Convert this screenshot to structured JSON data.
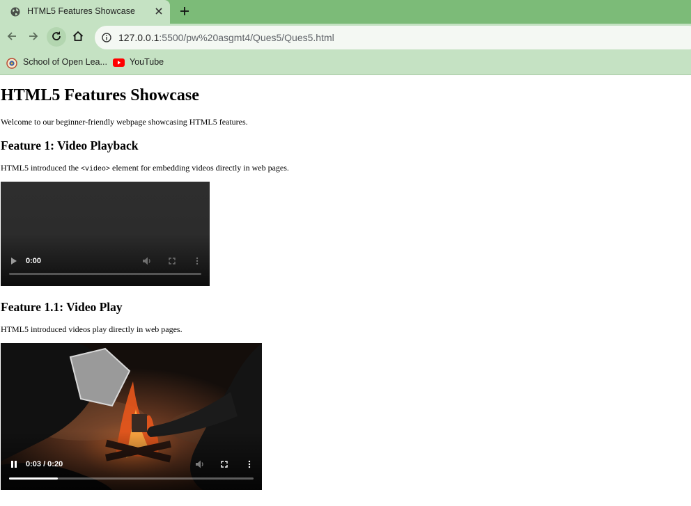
{
  "browser": {
    "tab": {
      "title": "HTML5 Features Showcase"
    },
    "url": {
      "host": "127.0.0.1",
      "rest": ":5500/pw%20asgmt4/Ques5/Ques5.html"
    },
    "bookmarks": [
      {
        "label": "School of Open Lea..."
      },
      {
        "label": "YouTube"
      }
    ]
  },
  "page": {
    "title": "HTML5 Features Showcase",
    "intro": "Welcome to our beginner-friendly webpage showcasing HTML5 features.",
    "feature1": {
      "heading": "Feature 1: Video Playback",
      "text_before": "HTML5 introduced the ",
      "code": "<video>",
      "text_after": " element for embedding videos directly in web pages.",
      "video": {
        "time": "0:00",
        "progress": 0
      }
    },
    "feature2": {
      "heading": "Feature 1.1: Video Play",
      "text": "HTML5 introduced videos play directly in web pages.",
      "video": {
        "time": "0:03 / 0:20",
        "progress": 0.2
      }
    }
  }
}
